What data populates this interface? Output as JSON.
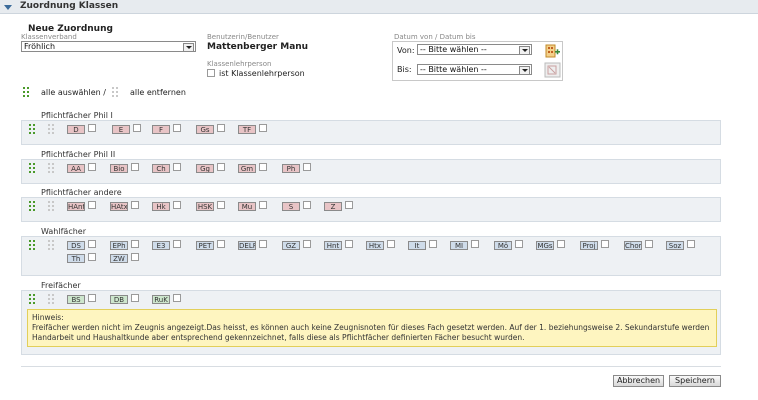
{
  "header": {
    "title": "Zuordnung Klassen"
  },
  "form": {
    "title": "Neue Zuordnung",
    "klassenverband": {
      "label": "Klassenverband",
      "value": "Fröhlich"
    },
    "benutzer": {
      "label": "Benutzerin/Benutzer",
      "value": "Mattenberger Manu"
    },
    "klassenlehrperson": {
      "label": "Klassenlehrperson",
      "checkbox_label": "ist Klassenlehrperson"
    },
    "datum": {
      "label": "Datum von / Datum bis",
      "von_label": "Von:",
      "von_value": "-- Bitte wählen --",
      "bis_label": "Bis:",
      "bis_value": "-- Bitte wählen --"
    },
    "select_all": "alle auswählen /",
    "remove_all": "alle entfernen"
  },
  "sections": [
    {
      "title": "Pflichtfächer Phil I",
      "subjects": [
        "D",
        "E",
        "F",
        "Gs",
        "TF"
      ]
    },
    {
      "title": "Pflichtfächer Phil II",
      "subjects": [
        "AA",
        "Bio",
        "Ch",
        "Gg",
        "Gm",
        "Ph"
      ]
    },
    {
      "title": "Pflichtfächer andere",
      "subjects": [
        "HAnt",
        "HAtx",
        "Hk",
        "HSK",
        "Mu",
        "S",
        "Z"
      ]
    },
    {
      "title": "Wahlfächer",
      "subjects": [
        "DS",
        "EPh",
        "E3",
        "PET",
        "DELF",
        "GZ",
        "Hnt",
        "Htx",
        "It",
        "MI",
        "Mö",
        "MGs",
        "Proj",
        "Chor",
        "Soz",
        "Th",
        "ZW"
      ]
    },
    {
      "title": "Freifächer",
      "subjects": [
        "BS",
        "DB",
        "RuK"
      ]
    }
  ],
  "hint": {
    "title": "Hinweis:",
    "text": "Freifächer werden nicht im Zeugnis angezeigt.Das heisst, es können auch keine Zeugnisnoten für dieses Fach gesetzt werden. Auf der 1. beziehungsweise 2. Sekundarstufe werden Handarbeit und Haushaltkunde aber entsprechend gekennzeichnet, falls diese als Pflichtfächer definierten Fächer besucht wurden."
  },
  "buttons": {
    "cancel": "Abbrechen",
    "save": "Speichern"
  },
  "colors": {
    "pflicht": "#e8c4c6",
    "wahl": "#cfdcea",
    "frei": "#cde6cd",
    "hint_bg": "#fef5c0",
    "icon_green": "#4a9a2a"
  }
}
